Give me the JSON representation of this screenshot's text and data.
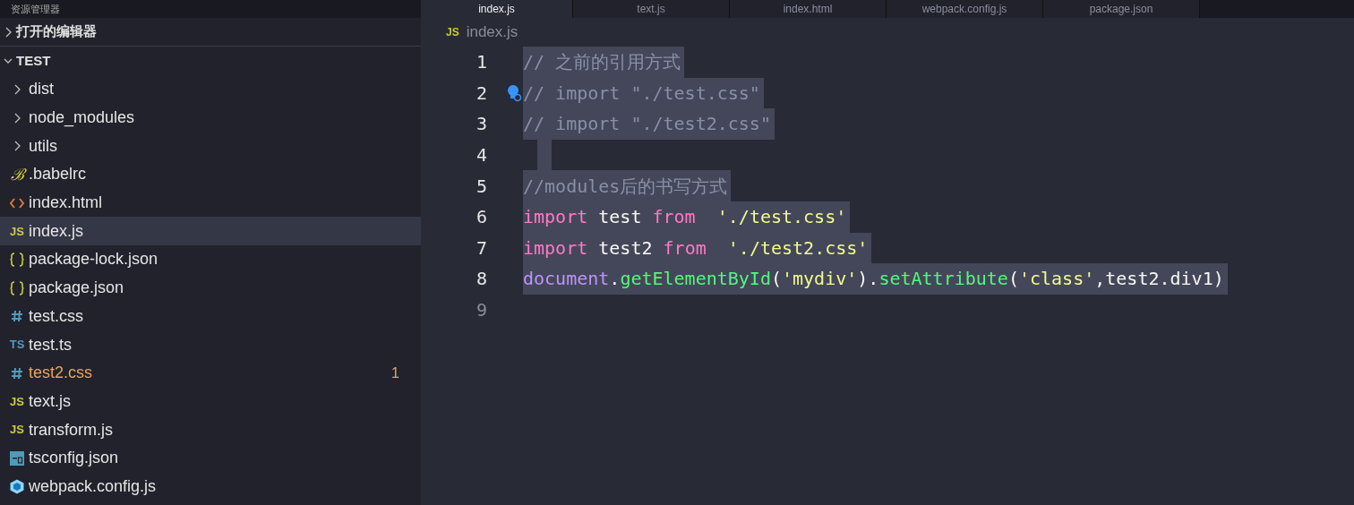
{
  "sidebar": {
    "title": "资源管理器",
    "sections": [
      {
        "label": "打开的编辑器",
        "expanded": false
      },
      {
        "label": "TEST",
        "expanded": true
      }
    ],
    "items": [
      {
        "kind": "folder",
        "label": "dist",
        "selected": false
      },
      {
        "kind": "folder",
        "label": "node_modules",
        "selected": false
      },
      {
        "kind": "folder",
        "label": "utils",
        "selected": false
      },
      {
        "kind": "babel",
        "icon": "ℬ",
        "label": ".babelrc",
        "selected": false
      },
      {
        "kind": "html",
        "label": "index.html",
        "selected": false
      },
      {
        "kind": "js",
        "icon": "JS",
        "label": "index.js",
        "selected": true
      },
      {
        "kind": "json",
        "label": "package-lock.json",
        "selected": false
      },
      {
        "kind": "json",
        "label": "package.json",
        "selected": false
      },
      {
        "kind": "css",
        "label": "test.css",
        "selected": false
      },
      {
        "kind": "ts",
        "icon": "TS",
        "label": "test.ts",
        "selected": false
      },
      {
        "kind": "css",
        "label": "test2.css",
        "selected": false,
        "warning": true,
        "badge": "1"
      },
      {
        "kind": "js",
        "icon": "JS",
        "label": "text.js",
        "selected": false
      },
      {
        "kind": "js",
        "icon": "JS",
        "label": "transform.js",
        "selected": false
      },
      {
        "kind": "tsconfig",
        "label": "tsconfig.json",
        "selected": false
      },
      {
        "kind": "webpack",
        "label": "webpack.config.js",
        "selected": false
      }
    ]
  },
  "tabs": [
    {
      "label": "index.js",
      "selected": true
    },
    {
      "label": "text.js",
      "selected": false
    },
    {
      "label": "index.html",
      "selected": false
    },
    {
      "label": "webpack.config.js",
      "selected": false
    },
    {
      "label": "package.json",
      "selected": false
    }
  ],
  "breadcrumb": {
    "kind": "js",
    "icon": "JS",
    "label": "index.js"
  },
  "code": [
    {
      "number": "1",
      "selected": true,
      "tokens": [
        {
          "kind": "comment",
          "text": "// 之前的引用方式"
        }
      ]
    },
    {
      "number": "2",
      "selected": true,
      "lightbulb": true,
      "tokens": [
        {
          "kind": "comment",
          "text": "// import \"./test.css\""
        }
      ]
    },
    {
      "number": "3",
      "selected": true,
      "tokens": [
        {
          "kind": "comment",
          "text": "// import \"./test2.css\""
        }
      ]
    },
    {
      "number": "4",
      "selected": true
    },
    {
      "number": "5",
      "selected": true,
      "tokens": [
        {
          "kind": "comment",
          "text": "//modules后的书写方式"
        }
      ]
    },
    {
      "number": "6",
      "selected": true,
      "tokens": [
        {
          "kind": "keyword",
          "text": "import"
        },
        {
          "kind": "plain",
          "text": " test "
        },
        {
          "kind": "keyword",
          "text": "from"
        },
        {
          "kind": "string",
          "text": "  './test.css'"
        }
      ]
    },
    {
      "number": "7",
      "selected": true,
      "tokens": [
        {
          "kind": "keyword",
          "text": "import"
        },
        {
          "kind": "plain",
          "text": " test2 "
        },
        {
          "kind": "keyword",
          "text": "from"
        },
        {
          "kind": "string",
          "text": "  './test2.css'"
        }
      ]
    },
    {
      "number": "8",
      "selected": true,
      "tokens": [
        {
          "kind": "object",
          "text": "document"
        },
        {
          "kind": "plain",
          "text": "."
        },
        {
          "kind": "method",
          "text": "getElementById"
        },
        {
          "kind": "plain",
          "text": "("
        },
        {
          "kind": "string",
          "text": "'mydiv'"
        },
        {
          "kind": "plain",
          "text": ")."
        },
        {
          "kind": "method",
          "text": "setAttribute"
        },
        {
          "kind": "plain",
          "text": "("
        },
        {
          "kind": "string",
          "text": "'class'"
        },
        {
          "kind": "plain",
          "text": ",test2.div1)"
        }
      ]
    },
    {
      "number": "9",
      "selected": false
    }
  ]
}
